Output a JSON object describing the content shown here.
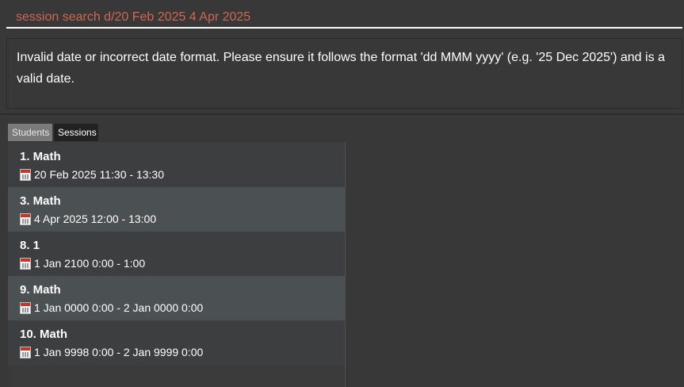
{
  "command": {
    "value": "session search d/20 Feb 2025 4 Apr 2025"
  },
  "result": {
    "message": "Invalid date or incorrect date format. Please ensure it follows the format 'dd MMM yyyy' (e.g. '25 Dec 2025') and is a valid date."
  },
  "tabs": [
    {
      "label": "Students",
      "selected": false
    },
    {
      "label": "Sessions",
      "selected": true
    }
  ],
  "sessions": [
    {
      "title": "1. Math",
      "time": "20 Feb 2025 11:30 - 13:30",
      "icon": "calendar-icon"
    },
    {
      "title": "3. Math",
      "time": "4 Apr 2025 12:00 - 13:00",
      "icon": "calendar-icon"
    },
    {
      "title": "8. 1",
      "time": "1 Jan 2100 0:00 - 1:00",
      "icon": "calendar-icon"
    },
    {
      "title": "9. Math",
      "time": "1 Jan 0000 0:00 - 2 Jan 0000 0:00",
      "icon": "calendar-icon"
    },
    {
      "title": "10. Math",
      "time": "1 Jan 9998 0:00 - 2 Jan 9999 0:00",
      "icon": "calendar-icon"
    }
  ],
  "colors": {
    "background": "#383838",
    "command_text": "#d06651",
    "row_even": "#3c3e3f",
    "row_odd": "#4b5052"
  }
}
